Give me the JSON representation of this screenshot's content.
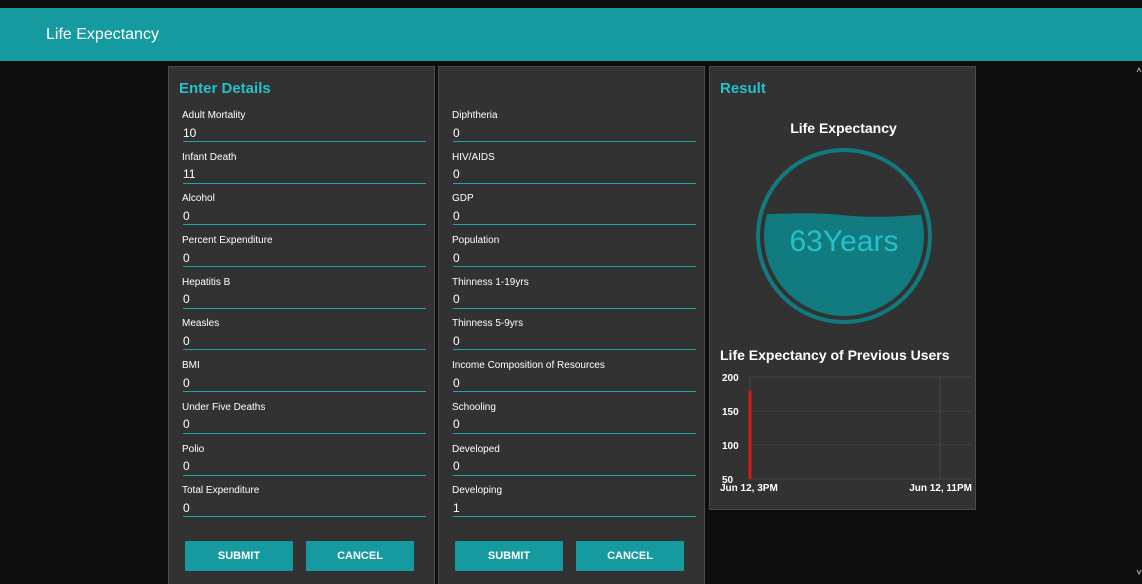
{
  "app": {
    "title": "Life Expectancy"
  },
  "panel1": {
    "heading": "Enter Details",
    "fields": [
      {
        "label": "Adult Mortality",
        "value": "10"
      },
      {
        "label": "Infant Death",
        "value": "11"
      },
      {
        "label": "Alcohol",
        "value": "0"
      },
      {
        "label": "Percent Expenditure",
        "value": "0"
      },
      {
        "label": "Hepatitis B",
        "value": "0"
      },
      {
        "label": "Measles",
        "value": "0"
      },
      {
        "label": "BMI",
        "value": "0"
      },
      {
        "label": "Under Five Deaths",
        "value": "0"
      },
      {
        "label": "Polio",
        "value": "0"
      },
      {
        "label": "Total Expenditure",
        "value": "0"
      }
    ],
    "submit_label": "SUBMIT",
    "cancel_label": "CANCEL"
  },
  "panel2": {
    "fields": [
      {
        "label": "Diphtheria",
        "value": "0"
      },
      {
        "label": "HIV/AIDS",
        "value": "0"
      },
      {
        "label": "GDP",
        "value": "0"
      },
      {
        "label": "Population",
        "value": "0"
      },
      {
        "label": "Thinness 1-19yrs",
        "value": "0"
      },
      {
        "label": "Thinness 5-9yrs",
        "value": "0"
      },
      {
        "label": "Income Composition of Resources",
        "value": "0"
      },
      {
        "label": "Schooling",
        "value": "0"
      },
      {
        "label": "Developed",
        "value": "0"
      },
      {
        "label": "Developing",
        "value": "1"
      }
    ],
    "submit_label": "SUBMIT",
    "cancel_label": "CANCEL"
  },
  "result": {
    "heading": "Result",
    "gauge_title": "Life Expectancy",
    "gauge_value": "63Years",
    "fill_fraction": 0.63
  },
  "chart_data": {
    "type": "bar",
    "title": "Life Expectancy of Previous Users",
    "x_ticks": [
      "Jun 12, 3PM",
      "Jun 12, 11PM"
    ],
    "y_ticks": [
      "200",
      "150",
      "100",
      "50"
    ],
    "ylim": [
      50,
      200
    ],
    "values": [
      {
        "x": "Jun 12, 3PM",
        "y": 180
      }
    ],
    "bar_color": "#d11a1a",
    "grid": true
  },
  "colors": {
    "accent": "#159a9f",
    "accent_text": "#23c1c9",
    "panel_bg": "#323232",
    "page_bg": "#0e0e0e"
  }
}
